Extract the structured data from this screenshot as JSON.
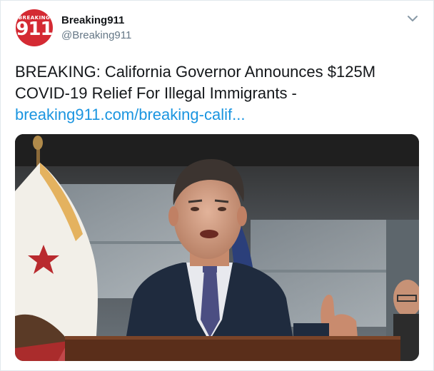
{
  "account": {
    "avatar_text_top": "BREAKING",
    "avatar_text_main": "911",
    "display_name": "Breaking911",
    "handle": "@Breaking911"
  },
  "tweet": {
    "line1": "BREAKING: California Governor Announces $125M",
    "line2": "COVID-19 Relief For Illegal Immigrants -",
    "link": "breaking911.com/breaking-calif..."
  },
  "icons": {
    "menu": "chevron-down-icon"
  },
  "colors": {
    "link": "#1b95e0",
    "avatar_bg": "#d42a33",
    "handle": "#657786"
  }
}
